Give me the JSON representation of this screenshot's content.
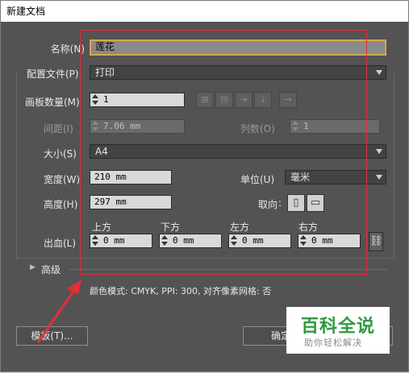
{
  "window": {
    "title": "新建文档"
  },
  "name": {
    "label": "名称(N)",
    "value": "莲花"
  },
  "profile": {
    "label": "配置文件(P)",
    "value": "打印"
  },
  "artboards": {
    "label": "画板数量(M)",
    "value": "1"
  },
  "spacing": {
    "label": "间距(I)",
    "value": "7.06 mm"
  },
  "columns": {
    "label": "列数(O)",
    "value": "1"
  },
  "size": {
    "label": "大小(S)",
    "value": "A4"
  },
  "width": {
    "label": "宽度(W)",
    "value": "210 mm"
  },
  "units": {
    "label": "单位(U)",
    "value": "毫米"
  },
  "height": {
    "label": "高度(H)",
    "value": "297 mm"
  },
  "orientation": {
    "label": "取向"
  },
  "bleed": {
    "label": "出血(L)",
    "top_label": "上方",
    "top_value": "0 mm",
    "bottom_label": "下方",
    "bottom_value": "0 mm",
    "left_label": "左方",
    "left_value": "0 mm",
    "right_label": "右方",
    "right_value": "0 mm"
  },
  "advanced": {
    "label": "高级"
  },
  "info": {
    "text": "颜色模式: CMYK, PPI: 300, 对齐像素网格: 否"
  },
  "buttons": {
    "templates": "模板(T)...",
    "ok": "确定"
  },
  "watermark": {
    "title": "百科全说",
    "subtitle": "助你轻松解决"
  },
  "colors": {
    "annotation": "#e0303a",
    "dialog_bg": "#535353",
    "name_focus": "#d7a84a",
    "watermark_green": "#2f9a3c"
  },
  "icons": [
    "chevron-down-icon",
    "spinner-up-icon",
    "spinner-down-icon",
    "grid-by-row-icon",
    "grid-by-column-icon",
    "arrange-by-row-icon",
    "arrange-by-column-icon",
    "right-to-left-icon",
    "portrait-icon",
    "landscape-icon",
    "link-icon",
    "disclosure-triangle-icon",
    "annotation-arrow-icon"
  ]
}
